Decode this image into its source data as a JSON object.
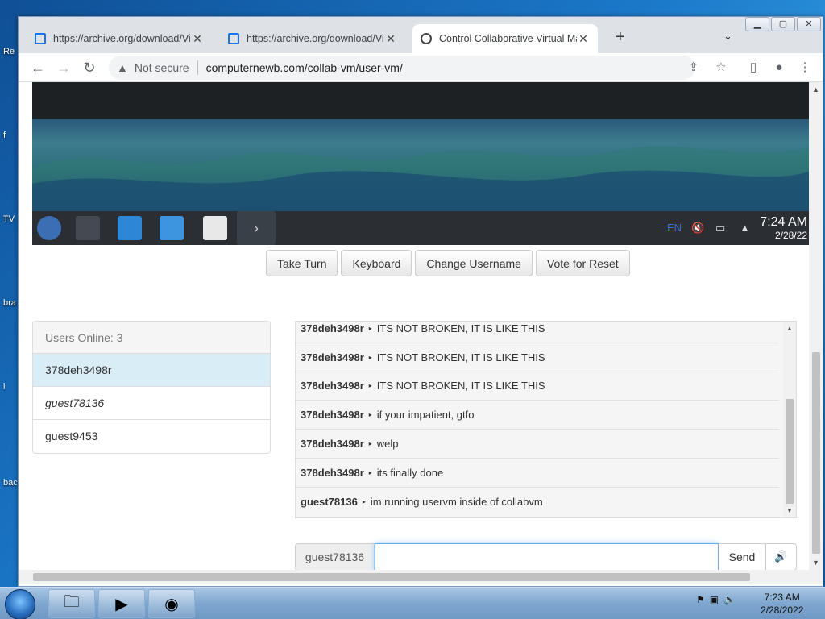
{
  "desktop": {
    "labels": [
      "Re",
      "f",
      "TV",
      "bra",
      "i",
      "bac"
    ]
  },
  "browser": {
    "tabs": [
      {
        "title": "https://archive.org/download/Vir"
      },
      {
        "title": "https://archive.org/download/Vir"
      },
      {
        "title": "Control Collaborative Virtual Ma"
      }
    ],
    "new_tab": "+",
    "security_label": "Not secure",
    "url": "computernewb.com/collab-vm/user-vm/"
  },
  "vm": {
    "taskbar_time": "7:24 AM",
    "taskbar_date": "2/28/22",
    "lang": "EN"
  },
  "controls": {
    "take_turn": "Take Turn",
    "keyboard": "Keyboard",
    "change_username": "Change Username",
    "vote_reset": "Vote for Reset"
  },
  "users": {
    "header": "Users Online: 3",
    "list": [
      {
        "name": "378deh3498r"
      },
      {
        "name": "guest78136"
      },
      {
        "name": "guest9453"
      }
    ]
  },
  "chat": {
    "messages": [
      {
        "user": "378deh3498r",
        "text": "ITS NOT BROKEN, IT IS LIKE THIS"
      },
      {
        "user": "378deh3498r",
        "text": "ITS NOT BROKEN, IT IS LIKE THIS"
      },
      {
        "user": "378deh3498r",
        "text": "ITS NOT BROKEN, IT IS LIKE THIS"
      },
      {
        "user": "378deh3498r",
        "text": "if your impatient, gtfo"
      },
      {
        "user": "378deh3498r",
        "text": "welp"
      },
      {
        "user": "378deh3498r",
        "text": "its finally done"
      },
      {
        "user": "guest78136",
        "text": "im running uservm inside of collabvm"
      }
    ],
    "input_username": "guest78136",
    "input_value": "",
    "send_label": "Send"
  },
  "windows": {
    "clock_time": "7:23 AM",
    "clock_date": "2/28/2022"
  }
}
